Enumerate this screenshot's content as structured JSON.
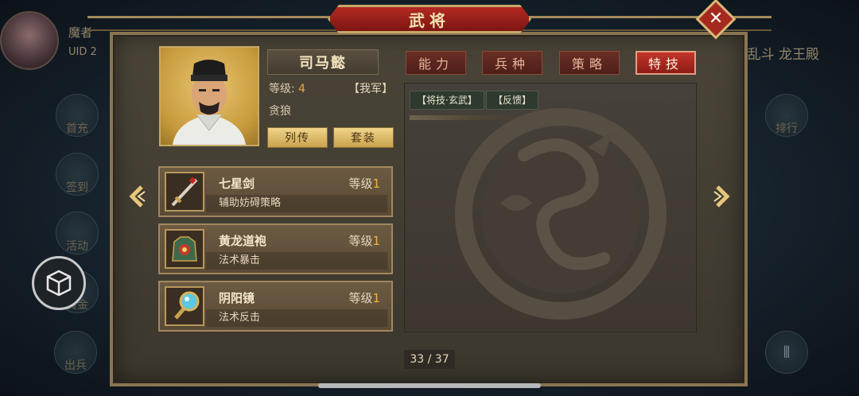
{
  "background": {
    "player_name": "魔者",
    "uid_label": "UID 2",
    "left_buttons": [
      "首充",
      "签到",
      "活动",
      "黄金",
      "出兵"
    ],
    "right_title": "乱斗 龙王殿",
    "right_buttons": [
      "排行"
    ]
  },
  "window": {
    "title": "武将"
  },
  "general": {
    "name": "司马懿",
    "level_label": "等级:",
    "level_value": "4",
    "faction": "【我军】",
    "trait": "贪狼",
    "buttons": {
      "biography": "列传",
      "outfit": "套装"
    }
  },
  "equipment": [
    {
      "name": "七星剑",
      "level_label": "等级",
      "level": "1",
      "desc": "辅助妨碍策略",
      "icon": "sword-icon"
    },
    {
      "name": "黄龙道袍",
      "level_label": "等级",
      "level": "1",
      "desc": "法术暴击",
      "icon": "robe-icon"
    },
    {
      "name": "阴阳镜",
      "level_label": "等级",
      "level": "1",
      "desc": "法术反击",
      "icon": "mirror-icon"
    }
  ],
  "tabs": [
    {
      "label": "能力",
      "active": false
    },
    {
      "label": "兵种",
      "active": false
    },
    {
      "label": "策略",
      "active": false
    },
    {
      "label": "特技",
      "active": true
    }
  ],
  "skills": [
    "【将技·玄武】",
    "【反馈】"
  ],
  "pager": {
    "text": "33 / 37"
  },
  "colors": {
    "accent_red": "#b32a22",
    "gold": "#e6c778",
    "level_orange": "#e8a83c"
  }
}
